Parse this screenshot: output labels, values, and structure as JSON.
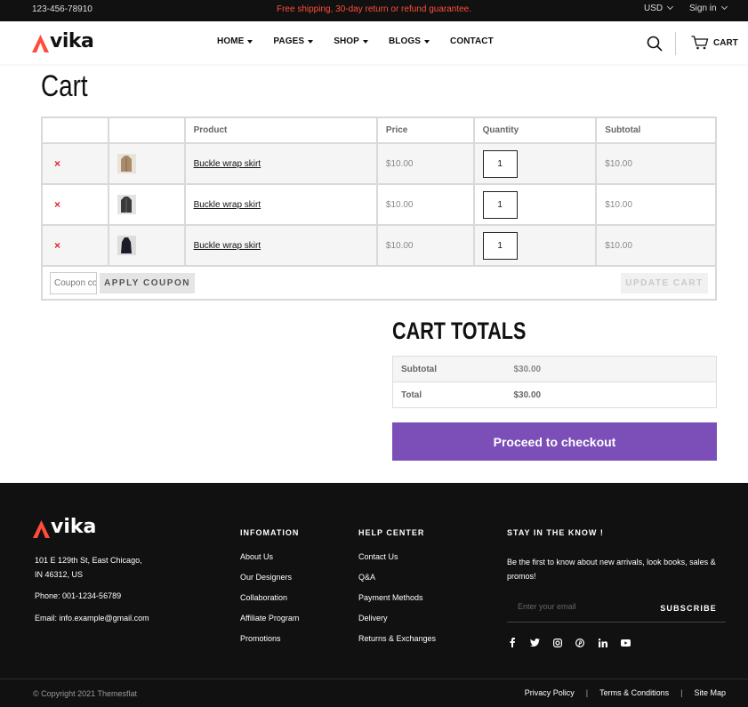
{
  "topbar": {
    "phone": "123-456-78910",
    "promo": "Free shipping, 30-day return or refund guarantee.",
    "currency": "USD",
    "signin": "Sign in"
  },
  "header": {
    "logo_text": "vika",
    "nav": [
      {
        "label": "HOME",
        "dropdown": true
      },
      {
        "label": "PAGES",
        "dropdown": true
      },
      {
        "label": "SHOP",
        "dropdown": true
      },
      {
        "label": "BLOGS",
        "dropdown": true
      },
      {
        "label": "CONTACT",
        "dropdown": false
      }
    ],
    "cart_label": "CART"
  },
  "page_title": "Cart",
  "cart": {
    "columns": [
      "",
      "",
      "Product",
      "Price",
      "Quantity",
      "Subtotal"
    ],
    "items": [
      {
        "product": "Buckle wrap skirt",
        "price": "$10.00",
        "quantity": "1",
        "subtotal": "$10.00",
        "remove": "×"
      },
      {
        "product": "Buckle wrap skirt",
        "price": "$10.00",
        "quantity": "1",
        "subtotal": "$10.00",
        "remove": "×"
      },
      {
        "product": "Buckle wrap skirt",
        "price": "$10.00",
        "quantity": "1",
        "subtotal": "$10.00",
        "remove": "×"
      }
    ],
    "coupon_placeholder": "Coupon code",
    "apply_label": "APPLY COUPON",
    "update_label": "UPDATE CART"
  },
  "totals": {
    "title": "CART TOTALS",
    "subtotal_label": "Subtotal",
    "subtotal_value": "$30.00",
    "total_label": "Total",
    "total_value": "$30.00",
    "checkout_label": "Proceed to checkout"
  },
  "footer": {
    "logo_text": "vika",
    "address_line1": "101 E 129th St, East Chicago,",
    "address_line2": "IN 46312, US",
    "phone": "Phone: 001-1234-56789",
    "email": "Email: info.example@gmail.com",
    "info_title": "INFOMATION",
    "info_links": [
      "About Us",
      "Our Designers",
      "Collaboration",
      "Affiliate Program",
      "Promotions"
    ],
    "help_title": "HELP CENTER",
    "help_links": [
      "Contact Us",
      "Q&A",
      "Payment Methods",
      "Delivery",
      "Returns & Exchanges"
    ],
    "news_title": "STAY IN THE KNOW !",
    "news_text": "Be the first to know about new arrivals, look books, sales & promos!",
    "email_placeholder": "Enter your email",
    "subscribe_label": "SUBSCRIBE",
    "socials": [
      "facebook-icon",
      "twitter-icon",
      "instagram-icon",
      "pinterest-icon",
      "linkedin-icon",
      "youtube-icon"
    ],
    "copyright": "© Copyright 2021 Themesflat",
    "bottom_links": [
      "Privacy Policy",
      "Terms & Conditions",
      "Site Map"
    ],
    "brand_accent": "#ff4d3a"
  },
  "colors": {
    "accent": "#7b4fb7",
    "promo": "#ff4d3a",
    "remove": "#e4262d",
    "dark": "#111111"
  }
}
